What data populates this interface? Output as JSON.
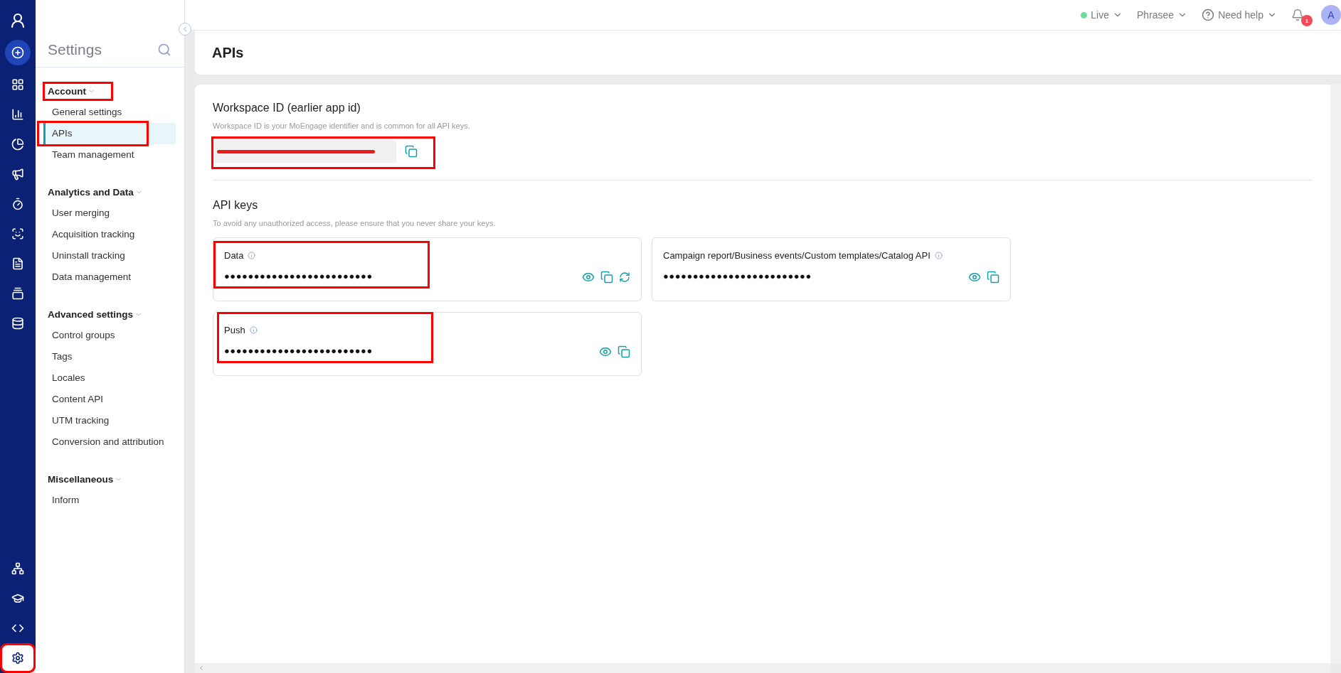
{
  "rail": {
    "items": [
      {
        "kind": "logo",
        "selected": false,
        "highlighted": false
      },
      {
        "kind": "create",
        "selected": false,
        "highlighted": false
      },
      {
        "kind": "dashboard",
        "selected": false,
        "highlighted": false
      },
      {
        "kind": "analytics",
        "selected": false,
        "highlighted": false
      },
      {
        "kind": "segments",
        "selected": false,
        "highlighted": false
      },
      {
        "kind": "campaigns",
        "selected": false,
        "highlighted": false
      },
      {
        "kind": "timer",
        "selected": false,
        "highlighted": false
      },
      {
        "kind": "audience",
        "selected": false,
        "highlighted": false
      },
      {
        "kind": "document",
        "selected": false,
        "highlighted": false
      },
      {
        "kind": "content",
        "selected": false,
        "highlighted": false
      },
      {
        "kind": "database",
        "selected": false,
        "highlighted": false
      }
    ],
    "bottom_items": [
      {
        "kind": "network",
        "selected": false,
        "highlighted": false
      },
      {
        "kind": "academy",
        "selected": false,
        "highlighted": false
      },
      {
        "kind": "code",
        "selected": false,
        "highlighted": false
      },
      {
        "kind": "settings",
        "selected": true,
        "highlighted": true
      }
    ]
  },
  "sidebar": {
    "title": "Settings",
    "sections": [
      {
        "label": "Account",
        "highlighted": true,
        "items": [
          {
            "label": "General settings",
            "selected": false,
            "highlighted": false
          },
          {
            "label": "APIs",
            "selected": true,
            "highlighted": true
          },
          {
            "label": "Team management",
            "selected": false,
            "highlighted": false
          }
        ]
      },
      {
        "label": "Analytics and Data",
        "highlighted": false,
        "items": [
          {
            "label": "User merging",
            "selected": false,
            "highlighted": false
          },
          {
            "label": "Acquisition tracking",
            "selected": false,
            "highlighted": false
          },
          {
            "label": "Uninstall tracking",
            "selected": false,
            "highlighted": false
          },
          {
            "label": "Data management",
            "selected": false,
            "highlighted": false
          }
        ]
      },
      {
        "label": "Advanced settings",
        "highlighted": false,
        "items": [
          {
            "label": "Control groups",
            "selected": false,
            "highlighted": false
          },
          {
            "label": "Tags",
            "selected": false,
            "highlighted": false
          },
          {
            "label": "Locales",
            "selected": false,
            "highlighted": false
          },
          {
            "label": "Content API",
            "selected": false,
            "highlighted": false
          },
          {
            "label": "UTM tracking",
            "selected": false,
            "highlighted": false
          },
          {
            "label": "Conversion and attribution",
            "selected": false,
            "highlighted": false
          }
        ]
      },
      {
        "label": "Miscellaneous",
        "highlighted": false,
        "items": [
          {
            "label": "Inform",
            "selected": false,
            "highlighted": false
          }
        ]
      }
    ]
  },
  "top_bar": {
    "environment": {
      "label": "Live",
      "color": "#6fdc9a"
    },
    "workspace": "Phrasee",
    "help": "Need help",
    "notifications": "1",
    "avatar": "A"
  },
  "page": {
    "title": "APIs",
    "workspace_id": {
      "heading": "Workspace ID (earlier app id)",
      "description": "Workspace ID is your MoEngage identifier and is common for all API keys.",
      "redacted": true,
      "highlighted": true
    },
    "api_keys": {
      "heading": "API keys",
      "description": "To avoid any unauthorized access, please ensure that you never share your keys.",
      "keys": [
        {
          "label": "Data",
          "value": "●●●●●●●●●●●●●●●●●●●●●●●●●",
          "regenerate": true,
          "highlighted": true
        },
        {
          "label": "Campaign report/Business events/Custom templates/Catalog API",
          "value": "●●●●●●●●●●●●●●●●●●●●●●●●●",
          "regenerate": false,
          "highlighted": false
        },
        {
          "label": "Push",
          "value": "●●●●●●●●●●●●●●●●●●●●●●●●●",
          "regenerate": false,
          "highlighted": true
        }
      ]
    }
  }
}
